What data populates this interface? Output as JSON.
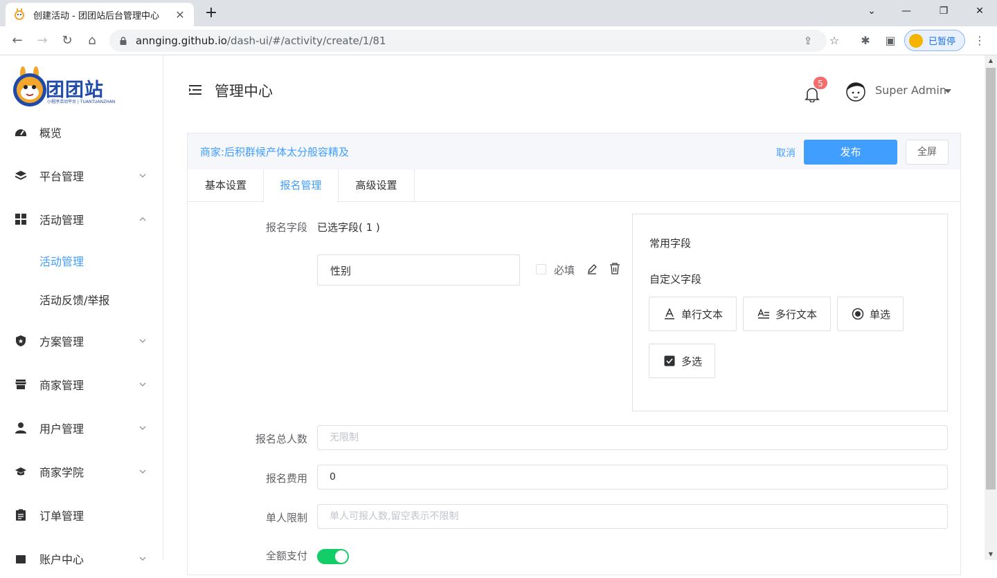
{
  "browser": {
    "tab_title": "创建活动 - 团团站后台管理中心",
    "url_host": "annging.github.io",
    "url_path": "/dash-ui/#/activity/create/1/81",
    "profile_label": "已暂停"
  },
  "sidebar": {
    "logo_text": "团团站",
    "logo_sub": "小程序活动平台 | TUANTUANZHAN",
    "items": [
      {
        "label": "概览",
        "icon": "dashboard-icon",
        "arrow": "none"
      },
      {
        "label": "平台管理",
        "icon": "layers-icon",
        "arrow": "down"
      },
      {
        "label": "活动管理",
        "icon": "grid-icon",
        "arrow": "up"
      },
      {
        "label": "方案管理",
        "icon": "shield-icon",
        "arrow": "down"
      },
      {
        "label": "商家管理",
        "icon": "store-icon",
        "arrow": "down"
      },
      {
        "label": "用户管理",
        "icon": "user-icon",
        "arrow": "down"
      },
      {
        "label": "商家学院",
        "icon": "graduation-icon",
        "arrow": "down"
      },
      {
        "label": "订单管理",
        "icon": "clipboard-icon",
        "arrow": "none"
      },
      {
        "label": "账户中心",
        "icon": "account-icon",
        "arrow": "down"
      }
    ],
    "subitems": [
      {
        "label": "活动管理",
        "active": true
      },
      {
        "label": "活动反馈/举报",
        "active": false
      }
    ]
  },
  "header": {
    "title": "管理中心",
    "notifications": "5",
    "user_name": "Super Admin"
  },
  "card": {
    "merchant": "商家:后积群候产体太分般容精及",
    "cancel_label": "取消",
    "publish_label": "发布",
    "fullscreen_label": "全屏",
    "tabs": [
      "基本设置",
      "报名管理",
      "高级设置"
    ],
    "active_tab": "报名管理"
  },
  "form": {
    "fields_label": "报名字段",
    "selected_count": "已选字段( 1 )",
    "selected_field": "性别",
    "required_label": "必填",
    "common_fields": "常用字段",
    "custom_fields": "自定义字段",
    "field_types": [
      {
        "label": "单行文本",
        "icon": "text-icon"
      },
      {
        "label": "多行文本",
        "icon": "multiline-text-icon"
      },
      {
        "label": "单选",
        "icon": "radio-icon"
      },
      {
        "label": "多选",
        "icon": "checkbox-icon"
      }
    ],
    "total_label": "报名总人数",
    "total_placeholder": "无限制",
    "fee_label": "报名费用",
    "fee_value": "0",
    "limit_label": "单人限制",
    "limit_placeholder": "单人可报人数,留空表示不限制",
    "fullpay_label": "全额支付",
    "fullpay_on": true
  },
  "colors": {
    "accent": "#409eff",
    "badge": "#f56c6c",
    "toggle_on": "#13ce66"
  }
}
